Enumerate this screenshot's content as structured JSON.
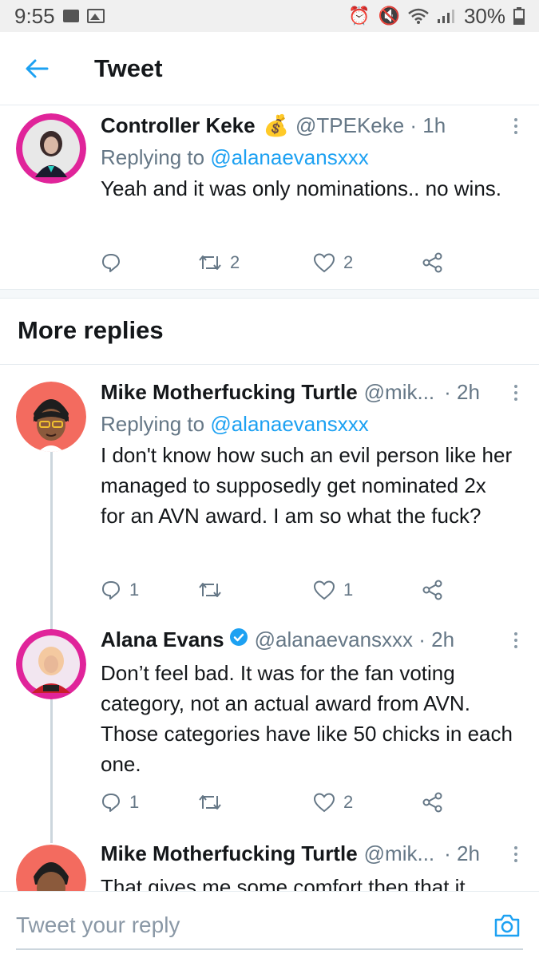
{
  "status_bar": {
    "time": "9:55",
    "battery": "30%"
  },
  "header": {
    "title": "Tweet"
  },
  "main_tweet": {
    "name": "Controller Keke",
    "emoji": "💰",
    "handle": "@TPEKeke · 1h",
    "replying_prefix": "Replying to",
    "replying_to": "@alanaevansxxx",
    "text": "Yeah and it was only nominations.. no wins.",
    "retweets": "2",
    "likes": "2"
  },
  "section": {
    "title": "More replies"
  },
  "replies": [
    {
      "name": "Mike Motherfucking Turtle",
      "handle": "@mik...",
      "time": "· 2h",
      "replying_prefix": "Replying to",
      "replying_to": "@alanaevansxxx",
      "text": "I don't know how such an evil person like her managed to supposedly get nominated 2x for an AVN award. I am so what the fuck?",
      "replies": "1",
      "retweets": "",
      "likes": "1"
    },
    {
      "name": "Alana Evans",
      "handle": "@alanaevansxxx · 2h",
      "text": "Don’t feel bad. It was for the fan voting category, not an actual award from AVN. Those categories have like 50 chicks in each one.",
      "replies": "1",
      "retweets": "",
      "likes": "2"
    },
    {
      "name": "Mike Motherfucking Turtle",
      "handle": "@mik...",
      "time": "· 2h",
      "text": "That gives me some comfort then that it"
    }
  ],
  "composer": {
    "placeholder": "Tweet your reply"
  },
  "colors": {
    "accent": "#1da1f2",
    "secondary_text": "#657786",
    "divider": "#e6ecf0"
  }
}
